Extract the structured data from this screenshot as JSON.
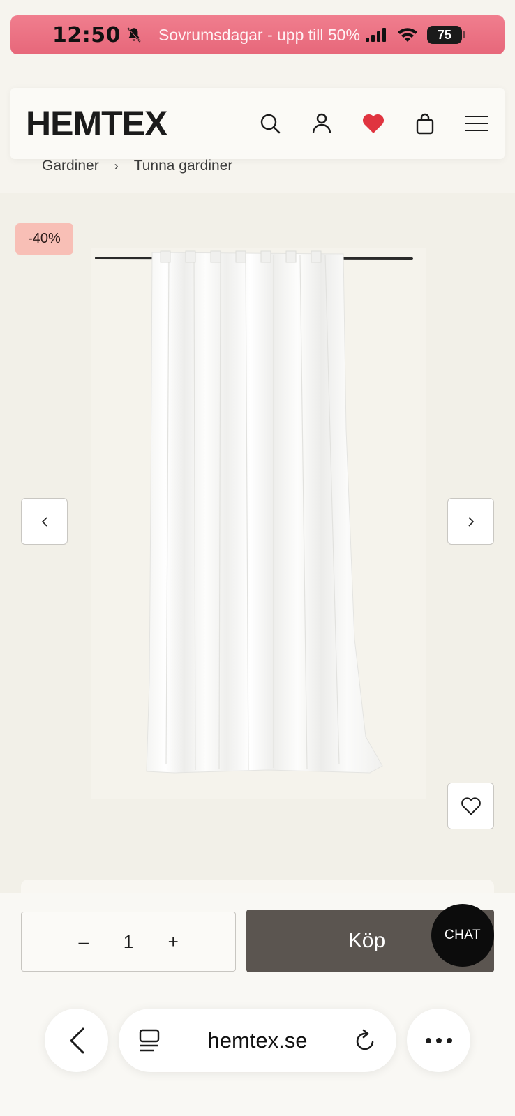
{
  "status_bar": {
    "time": "12:50",
    "promo_text": "Sovrumsdagar - upp till 50%",
    "battery": "75",
    "bg_color": "#e96c7e"
  },
  "header": {
    "logo": "HEMTEX",
    "icons": [
      "search-icon",
      "account-icon",
      "wishlist-heart-icon",
      "shopping-bag-icon",
      "hamburger-menu-icon"
    ],
    "accent_heart_color": "#e0343f"
  },
  "breadcrumb": {
    "items": [
      "Gardiner",
      "Tunna gardiner"
    ],
    "separator": "›"
  },
  "gallery": {
    "discount_badge": "-40%",
    "discount_color": "#f8bfb6",
    "image_subject": "white sheer curtain on black rod"
  },
  "purchase": {
    "quantity": "1",
    "minus": "–",
    "plus": "+",
    "buy_label": "Köp",
    "buy_color": "#5b5550",
    "chat_label": "CHAT"
  },
  "browser": {
    "url": "hemtex.se"
  }
}
